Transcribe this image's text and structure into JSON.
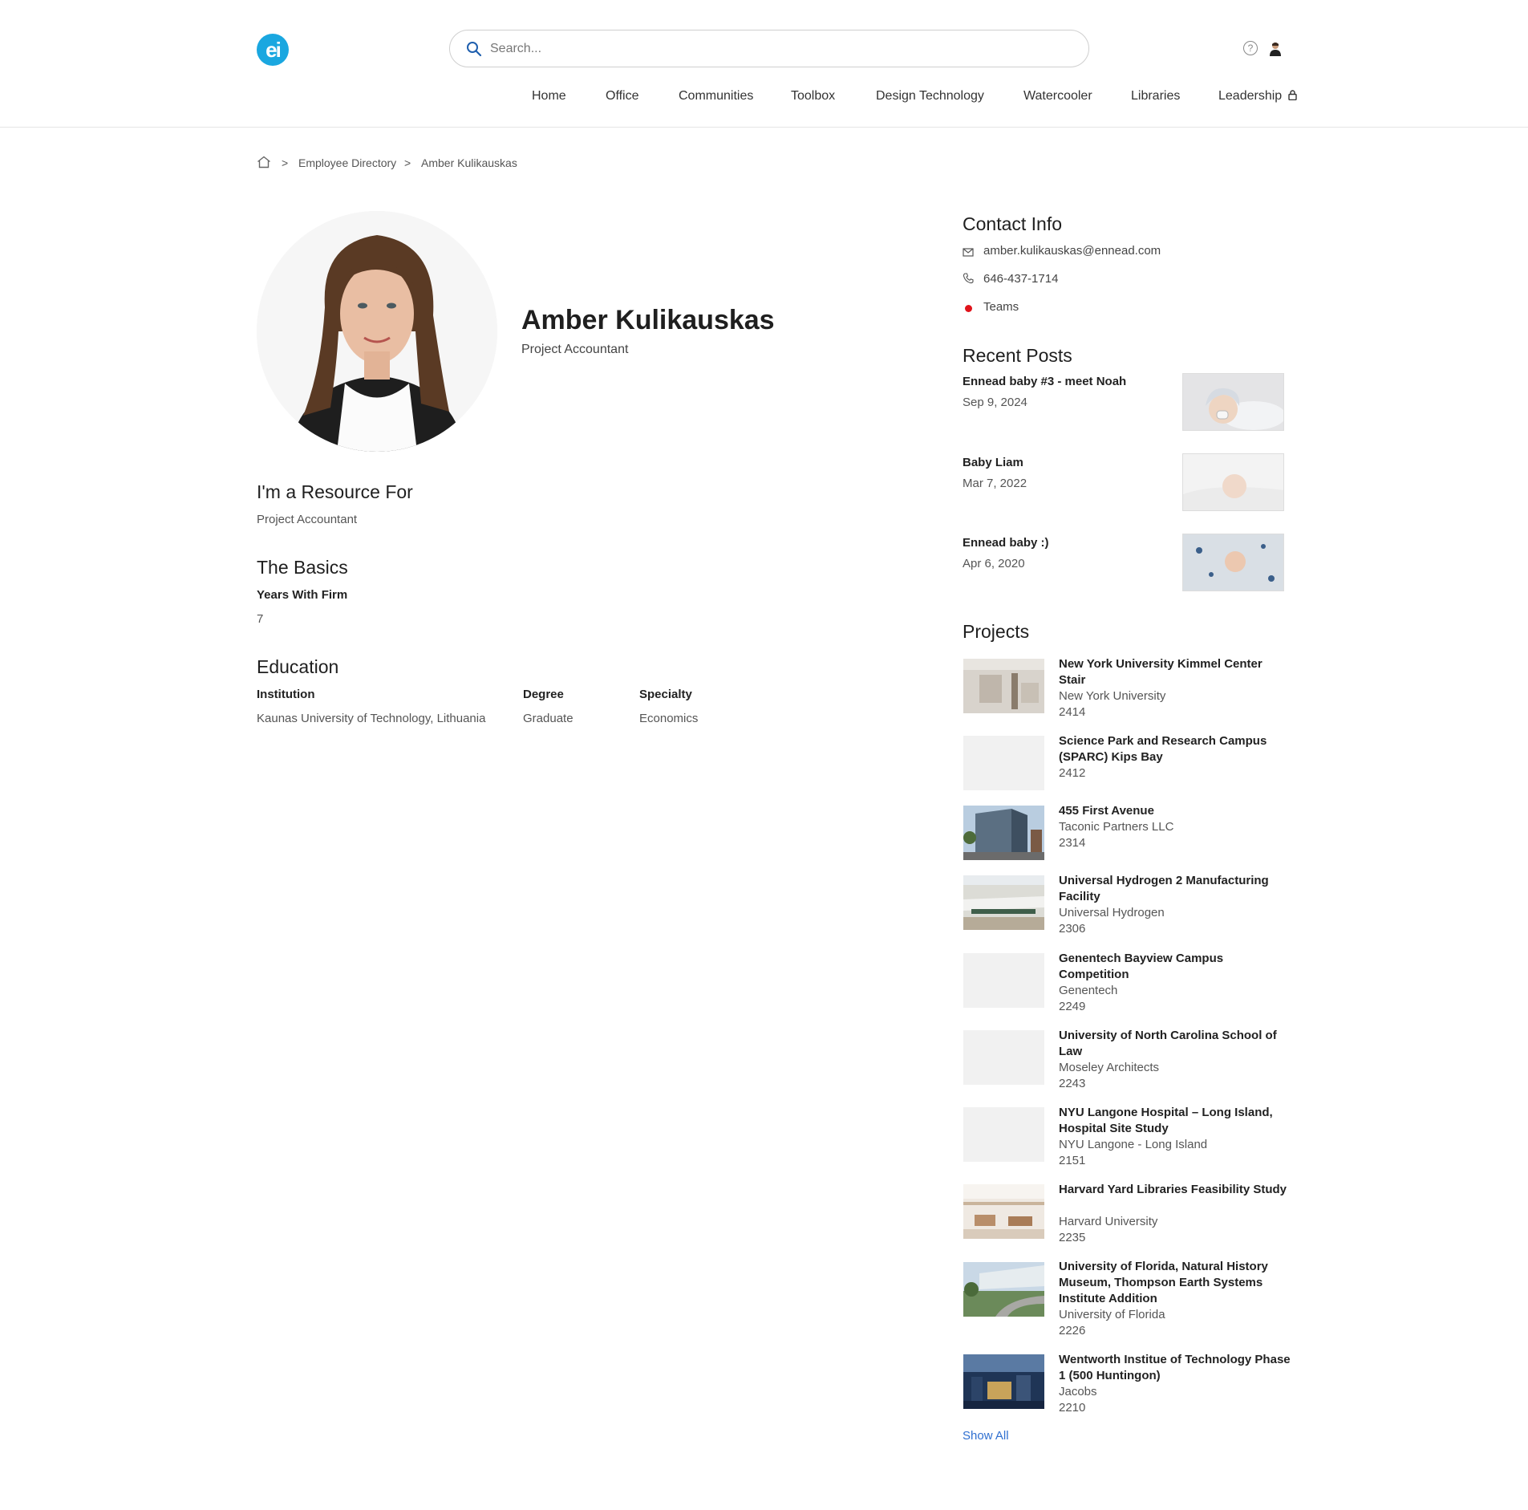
{
  "header": {
    "logo_text": "ei",
    "search_placeholder": "Search...",
    "nav": [
      "Home",
      "Office",
      "Communities",
      "Toolbox",
      "Design Technology",
      "Watercooler",
      "Libraries",
      "Leadership"
    ]
  },
  "breadcrumb": {
    "section": "Employee Directory",
    "current": "Amber Kulikauskas",
    "separator": ">"
  },
  "profile": {
    "name": "Amber Kulikauskas",
    "title": "Project Accountant",
    "resource_heading": "I'm a Resource For",
    "resource_value": "Project Accountant",
    "basics_heading": "The Basics",
    "years_label": "Years With Firm",
    "years_value": "7",
    "education_heading": "Education",
    "edu_cols": [
      "Institution",
      "Degree",
      "Specialty"
    ],
    "edu_row": [
      "Kaunas University of Technology, Lithuania",
      "Graduate",
      "Economics"
    ]
  },
  "contact": {
    "heading": "Contact Info",
    "email": "amber.kulikauskas@ennead.com",
    "phone": "646-437-1714",
    "teams": "Teams",
    "status_color": "#e0131b"
  },
  "posts": {
    "heading": "Recent Posts",
    "items": [
      {
        "title": "Ennead baby #3 - meet Noah",
        "date": "Sep 9, 2024"
      },
      {
        "title": "Baby Liam",
        "date": "Mar 7, 2022"
      },
      {
        "title": "Ennead baby :)",
        "date": "Apr 6, 2020"
      }
    ]
  },
  "projects": {
    "heading": "Projects",
    "show_all": "Show All",
    "items": [
      {
        "title": "New York University Kimmel Center Stair",
        "client": "New York University",
        "number": "2414"
      },
      {
        "title": "Science Park and Research Campus (SPARC) Kips Bay",
        "client": "",
        "number": "2412"
      },
      {
        "title": "455 First Avenue",
        "client": "Taconic Partners LLC",
        "number": "2314"
      },
      {
        "title": "Universal Hydrogen 2 Manufacturing Facility",
        "client": "Universal Hydrogen",
        "number": "2306"
      },
      {
        "title": "Genentech Bayview Campus Competition",
        "client": "Genentech",
        "number": "2249"
      },
      {
        "title": "University of North Carolina School of Law",
        "client": "Moseley Architects",
        "number": "2243"
      },
      {
        "title": "NYU Langone Hospital – Long Island, Hospital Site Study",
        "client": "NYU Langone - Long Island",
        "number": "2151"
      },
      {
        "title": "Harvard Yard Libraries Feasibility Study",
        "client": "Harvard University",
        "number": "2235"
      },
      {
        "title": "University of Florida, Natural History Museum, Thompson Earth Systems Institute Addition",
        "client": "University of Florida",
        "number": "2226"
      },
      {
        "title": "Wentworth Institue of Technology Phase 1 (500 Huntingon)",
        "client": "Jacobs",
        "number": "2210"
      }
    ]
  }
}
